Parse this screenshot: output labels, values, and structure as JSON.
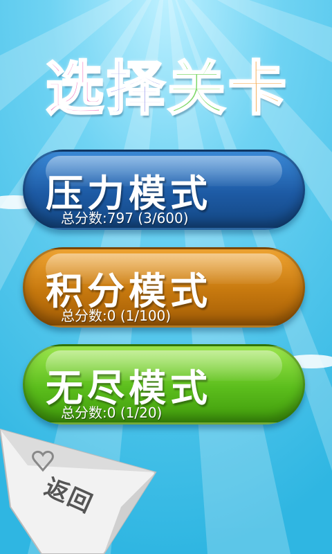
{
  "screen": {
    "title_chars": [
      "选",
      "择",
      "关",
      "卡"
    ],
    "title_colors": [
      "#f07ec2",
      "#8c8fe8",
      "#7fd86a",
      "#f5a74a"
    ]
  },
  "modes": [
    {
      "name": "压力模式",
      "score_label": "总分数:",
      "score": "797",
      "progress": "(3/600)",
      "color": "#1d5aa4"
    },
    {
      "name": "积分模式",
      "score_label": "总分数:",
      "score": "0",
      "progress": "(1/100)",
      "color": "#c6780e"
    },
    {
      "name": "无尽模式",
      "score_label": "总分数:",
      "score": "0",
      "progress": "(1/20)",
      "color": "#5bbd1c"
    }
  ],
  "back_button": {
    "label": "返回"
  }
}
